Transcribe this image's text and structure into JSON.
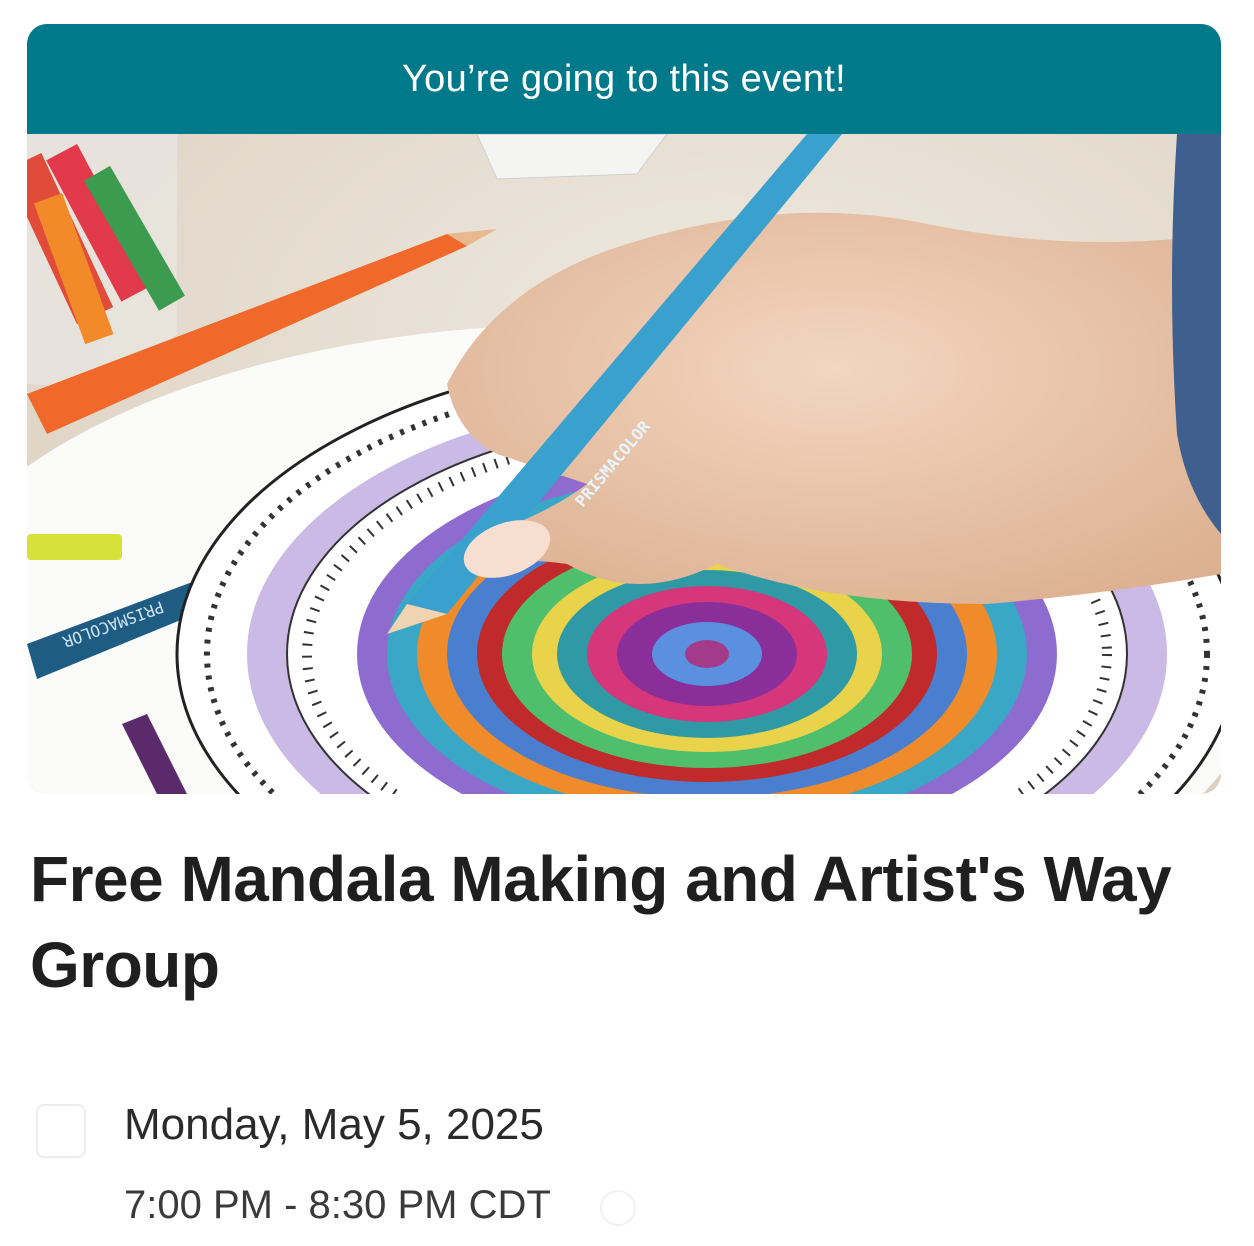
{
  "event": {
    "rsvp_banner": "You’re going to this event!",
    "title": "Free Mandala Making and Artist's Way Group",
    "date": "Monday, May 5, 2025",
    "time": "7:00 PM - 8:30 PM CDT",
    "image": {
      "pencil_brand_text": "PRISMACOLOR",
      "pencil_brand_text_flipped": "PRISMACOLOR"
    }
  },
  "icons": {
    "calendar": "calendar-icon",
    "share": "share-icon"
  },
  "colors": {
    "banner": "#00798a",
    "banner_text": "#ffffff",
    "title_text": "#1f1f1f"
  }
}
